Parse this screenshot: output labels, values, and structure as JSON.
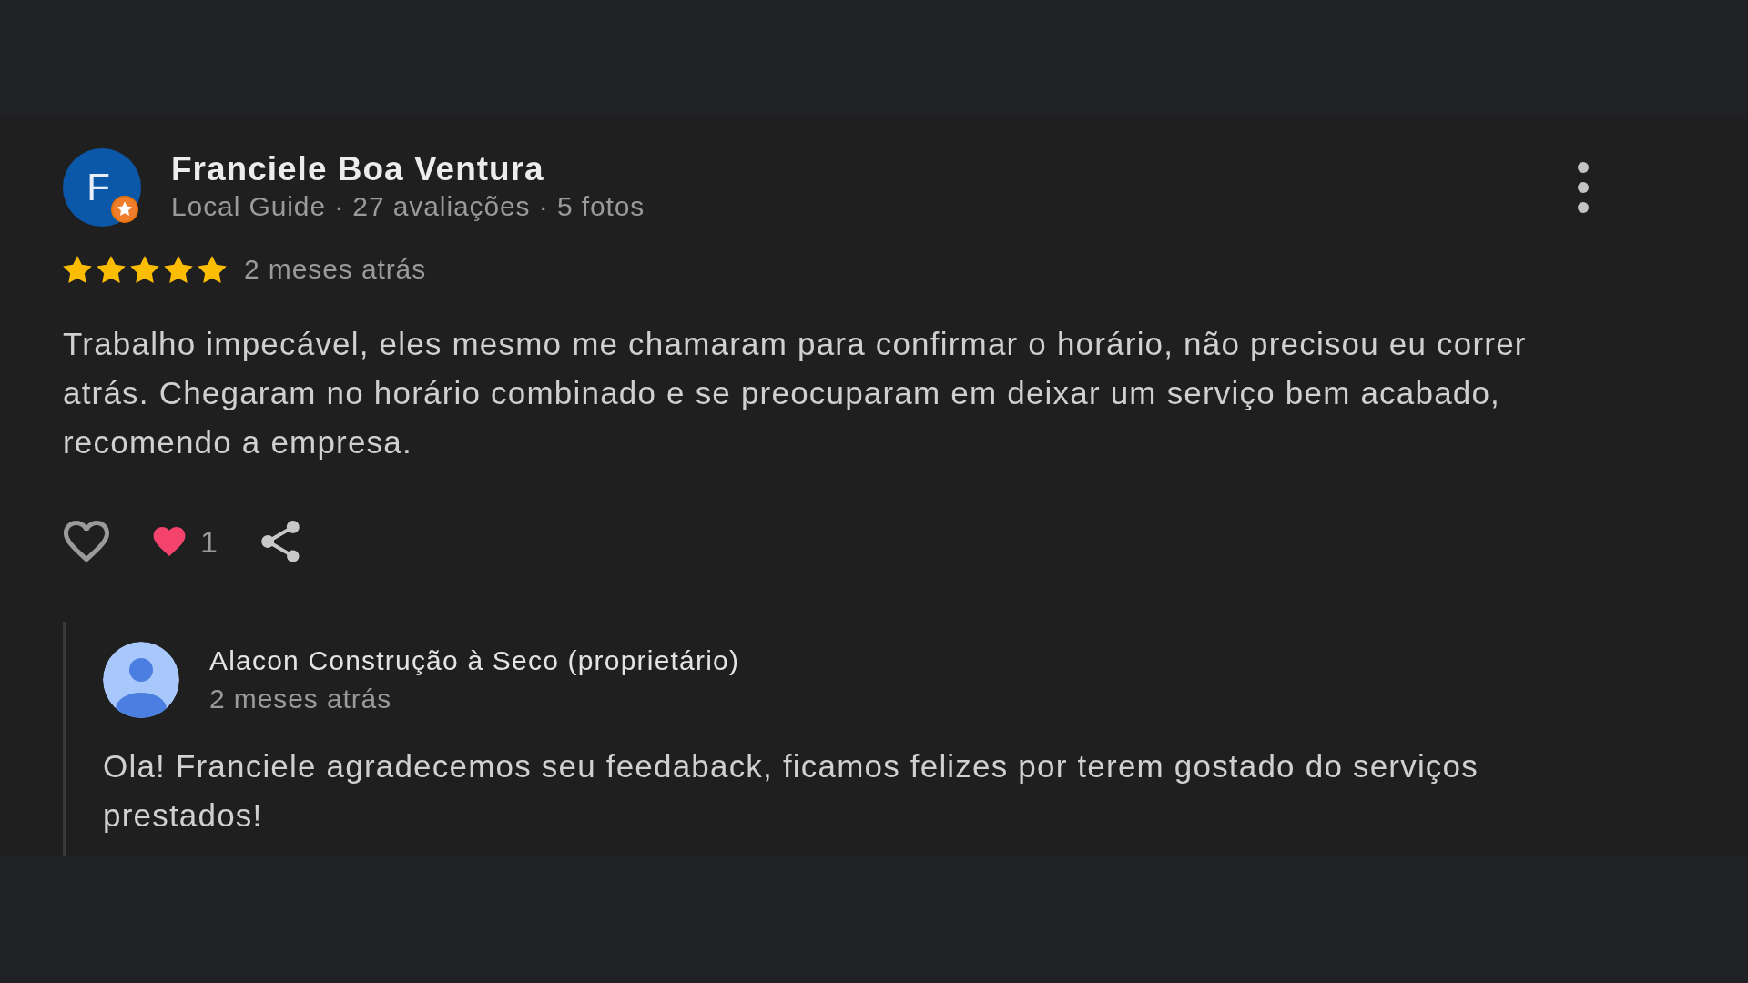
{
  "review": {
    "author": {
      "initial": "F",
      "name": "Franciele Boa Ventura",
      "meta": "Local Guide · 27 avaliações · 5 fotos",
      "local_guide": true
    },
    "stars": 5,
    "time": "2 meses atrás",
    "text": "Trabalho impecável, eles mesmo me chamaram para confirmar o horário, não precisou eu correr atrás. Chegaram no horário combinado e se preocuparam em deixar um serviço bem acabado, recomendo a empresa.",
    "liked": false,
    "reaction_count": "1",
    "reply": {
      "name": "Alacon Construção à Seco (proprietário)",
      "time": "2 meses atrás",
      "text": "Ola! Franciele agradecemos seu feedaback, ficamos felizes por terem gostado do serviços prestados!"
    }
  }
}
